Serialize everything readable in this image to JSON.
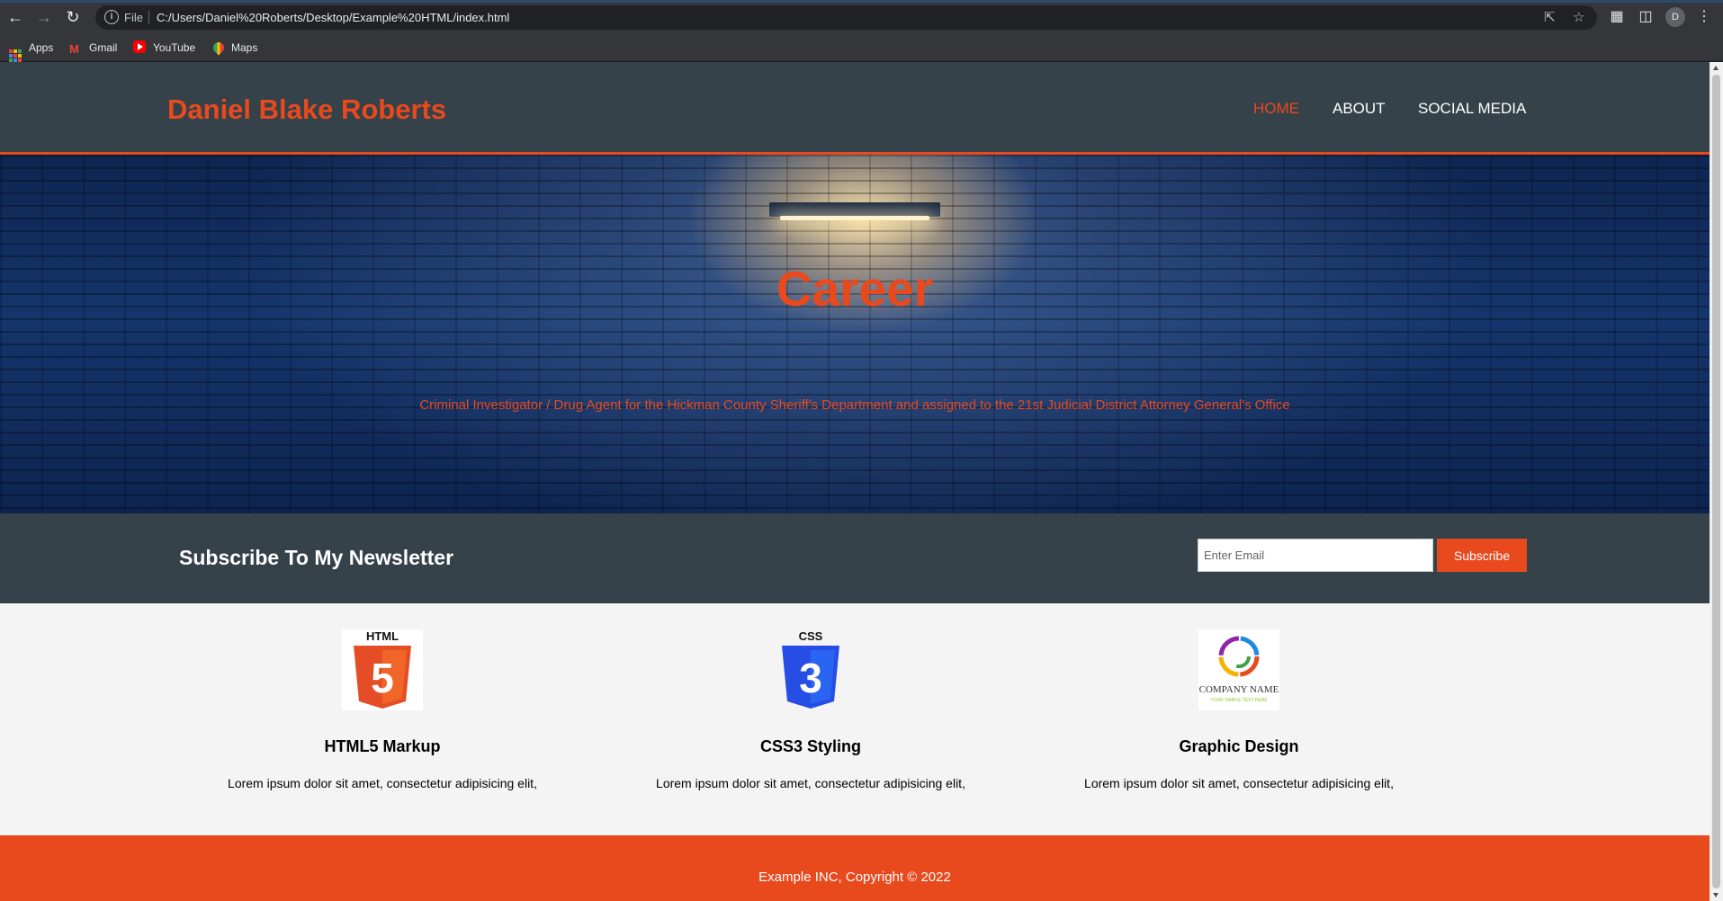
{
  "browser": {
    "url_scheme_label": "File",
    "url": "C:/Users/Daniel%20Roberts/Desktop/Example%20HTML/index.html",
    "profile_initial": "D",
    "bookmarks": [
      {
        "label": "Apps",
        "icon": "apps-grid-icon"
      },
      {
        "label": "Gmail",
        "icon": "gmail-icon"
      },
      {
        "label": "YouTube",
        "icon": "youtube-icon"
      },
      {
        "label": "Maps",
        "icon": "maps-icon"
      }
    ]
  },
  "site": {
    "brand": "Daniel Blake Roberts",
    "nav": [
      {
        "label": "HOME",
        "active": true
      },
      {
        "label": "ABOUT",
        "active": false
      },
      {
        "label": "SOCIAL MEDIA",
        "active": false
      }
    ],
    "hero": {
      "title": "Career",
      "subtitle": "Criminal Investigator / Drug Agent for the Hickman County Sheriff's Department and assigned to the 21st Judicial District Attorney General's Office"
    },
    "newsletter": {
      "title": "Subscribe To My Newsletter",
      "email_placeholder": "Enter Email",
      "button_label": "Subscribe"
    },
    "boxes": [
      {
        "title": "HTML5 Markup",
        "text": "Lorem ipsum dolor sit amet, consectetur adipisicing elit,",
        "logo": "html5-logo",
        "logo_caption": "HTML",
        "logo_glyph": "5"
      },
      {
        "title": "CSS3 Styling",
        "text": "Lorem ipsum dolor sit amet, consectetur adipisicing elit,",
        "logo": "css3-logo",
        "logo_caption": "CSS",
        "logo_glyph": "3"
      },
      {
        "title": "Graphic Design",
        "text": "Lorem ipsum dolor sit amet, consectetur adipisicing elit,",
        "logo": "company-logo",
        "logo_caption": "COMPANY NAME",
        "logo_tagline": "YOUR SIMPLE TEXT HERE"
      }
    ],
    "footer": "Example INC, Copyright © 2022"
  },
  "colors": {
    "accent": "#e8491d",
    "header_bg": "#35424a",
    "page_bg": "#f4f4f4"
  }
}
